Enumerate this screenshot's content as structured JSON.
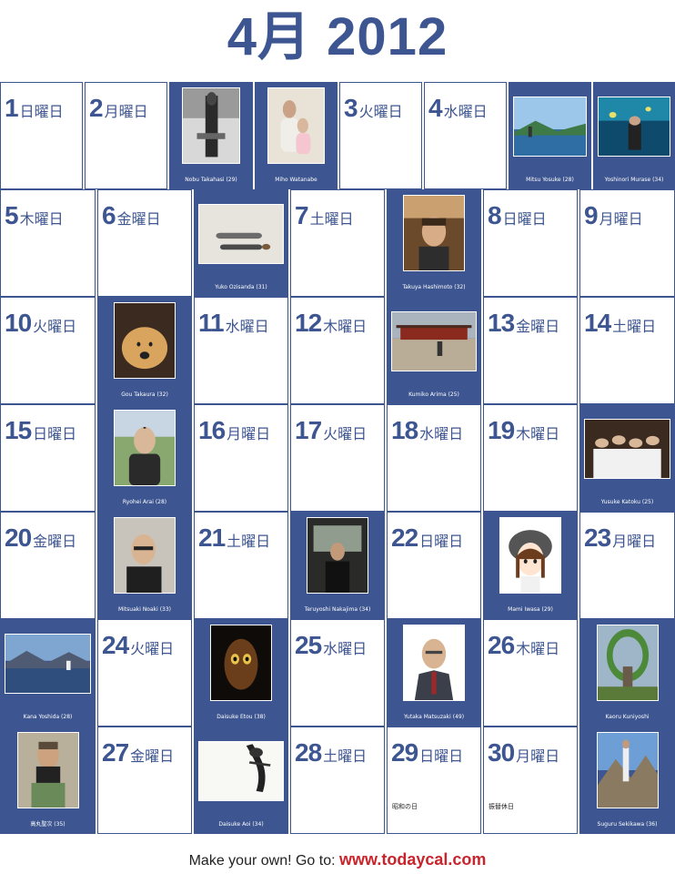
{
  "title": "4月 2012",
  "colors": {
    "blue": "#3d5590",
    "link_red": "#c9242b"
  },
  "footer": {
    "prefix": "Make your own! Go to:",
    "link": "www.todaycal.com"
  },
  "rows": [
    [
      {
        "type": "day",
        "num": "1",
        "name": "日曜日"
      },
      {
        "type": "day",
        "num": "2",
        "name": "月曜日"
      },
      {
        "type": "photo",
        "caption": "Nobu Takahasi (29)",
        "scene": "person-bw"
      },
      {
        "type": "photo",
        "caption": "Miho Watanabe",
        "scene": "mother-child"
      },
      {
        "type": "day",
        "num": "3",
        "name": "火曜日"
      },
      {
        "type": "day",
        "num": "4",
        "name": "水曜日"
      },
      {
        "type": "photo",
        "caption": "Mitsu Yosuke (28)",
        "scene": "sea-view"
      },
      {
        "type": "photo",
        "caption": "Yoshinori Murase (34)",
        "scene": "aquarium"
      }
    ],
    [
      {
        "type": "day",
        "num": "5",
        "name": "木曜日"
      },
      {
        "type": "day",
        "num": "6",
        "name": "金曜日"
      },
      {
        "type": "photo",
        "caption": "Yuko Ozisanda (31)",
        "scene": "lying-snow"
      },
      {
        "type": "day",
        "num": "7",
        "name": "土曜日"
      },
      {
        "type": "photo",
        "caption": "Takuya Hashimoto (32)",
        "scene": "man-restaurant"
      },
      {
        "type": "day",
        "num": "8",
        "name": "日曜日"
      },
      {
        "type": "day",
        "num": "9",
        "name": "月曜日"
      }
    ],
    [
      {
        "type": "day",
        "num": "10",
        "name": "火曜日"
      },
      {
        "type": "photo",
        "caption": "Gou Takaura (32)",
        "scene": "dog"
      },
      {
        "type": "day",
        "num": "11",
        "name": "水曜日"
      },
      {
        "type": "day",
        "num": "12",
        "name": "木曜日"
      },
      {
        "type": "photo",
        "caption": "Kumiko Arima (25)",
        "scene": "shrine"
      },
      {
        "type": "day",
        "num": "13",
        "name": "金曜日"
      },
      {
        "type": "day",
        "num": "14",
        "name": "土曜日"
      }
    ],
    [
      {
        "type": "day",
        "num": "15",
        "name": "日曜日"
      },
      {
        "type": "photo",
        "caption": "Ryohei Arai (28)",
        "scene": "man-outdoor"
      },
      {
        "type": "day",
        "num": "16",
        "name": "月曜日"
      },
      {
        "type": "day",
        "num": "17",
        "name": "火曜日"
      },
      {
        "type": "day",
        "num": "18",
        "name": "水曜日"
      },
      {
        "type": "day",
        "num": "19",
        "name": "木曜日"
      },
      {
        "type": "photo",
        "caption": "Yusuke Katoku (25)",
        "scene": "group"
      }
    ],
    [
      {
        "type": "day",
        "num": "20",
        "name": "金曜日"
      },
      {
        "type": "photo",
        "caption": "Mitsuaki Noaki (33)",
        "scene": "man-indoor"
      },
      {
        "type": "day",
        "num": "21",
        "name": "土曜日"
      },
      {
        "type": "photo",
        "caption": "Teruyoshi Nakajima (34)",
        "scene": "vehicle"
      },
      {
        "type": "day",
        "num": "22",
        "name": "日曜日"
      },
      {
        "type": "photo",
        "caption": "Mami Iwasa (29)",
        "scene": "cartoon-girl"
      },
      {
        "type": "day",
        "num": "23",
        "name": "月曜日"
      }
    ],
    [
      {
        "type": "photo",
        "caption": "Kana Yoshida (28)",
        "scene": "lake"
      },
      {
        "type": "day",
        "num": "24",
        "name": "火曜日"
      },
      {
        "type": "photo",
        "caption": "Daisuke Etou (38)",
        "scene": "dark-face"
      },
      {
        "type": "day",
        "num": "25",
        "name": "水曜日"
      },
      {
        "type": "photo",
        "caption": "Yutaka Matsuzaki (49)",
        "scene": "portrait-suit"
      },
      {
        "type": "day",
        "num": "26",
        "name": "木曜日"
      },
      {
        "type": "photo",
        "caption": "Kaoru Kuniyoshi",
        "scene": "flower-arch"
      }
    ],
    [
      {
        "type": "photo",
        "caption": "高丸聖次 (35)",
        "scene": "man-camera"
      },
      {
        "type": "day",
        "num": "27",
        "name": "金曜日"
      },
      {
        "type": "photo",
        "caption": "Daisuke Aoi (34)",
        "scene": "sketch"
      },
      {
        "type": "day",
        "num": "28",
        "name": "土曜日"
      },
      {
        "type": "day",
        "num": "29",
        "name": "日曜日",
        "holiday": "昭和の日"
      },
      {
        "type": "day",
        "num": "30",
        "name": "月曜日",
        "holiday": "振替休日"
      },
      {
        "type": "photo",
        "caption": "Suguru Sekikawa (36)",
        "scene": "mountain"
      }
    ]
  ]
}
